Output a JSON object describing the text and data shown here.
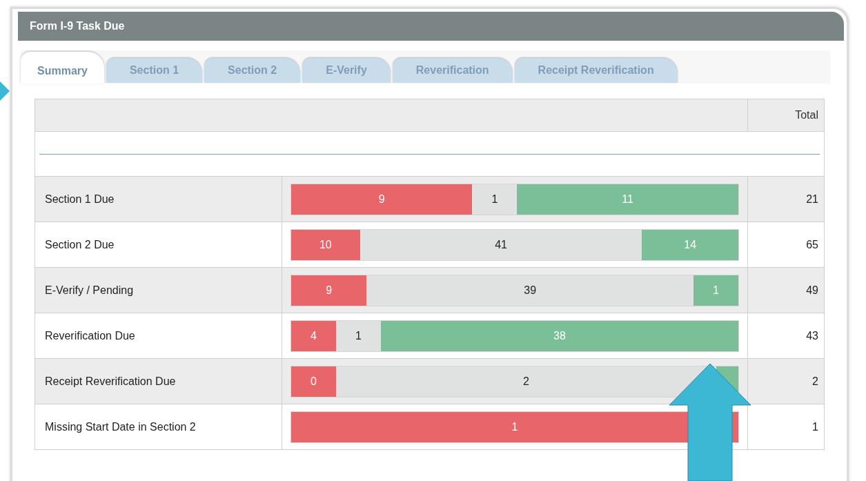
{
  "panel": {
    "title": "Form I-9 Task Due"
  },
  "tabs": [
    {
      "label": "Summary",
      "selected": true
    },
    {
      "label": "Section 1",
      "selected": false
    },
    {
      "label": "Section 2",
      "selected": false
    },
    {
      "label": "E-Verify",
      "selected": false
    },
    {
      "label": "Reverification",
      "selected": false
    },
    {
      "label": "Receipt Reverification",
      "selected": false
    }
  ],
  "table": {
    "columns": {
      "column_3": "Total"
    },
    "rows": [
      {
        "label": "Section 1 Due",
        "total": "21",
        "segments": [
          {
            "kind": "overdue",
            "text": "9"
          },
          {
            "kind": "pending",
            "text": "1"
          },
          {
            "kind": "ontime",
            "text": "11"
          }
        ]
      },
      {
        "label": "Section 2 Due",
        "total": "65",
        "segments": [
          {
            "kind": "overdue",
            "text": "10"
          },
          {
            "kind": "pending",
            "text": "41"
          },
          {
            "kind": "ontime",
            "text": "14"
          }
        ]
      },
      {
        "label": "E-Verify / Pending",
        "total": "49",
        "segments": [
          {
            "kind": "overdue",
            "text": "9"
          },
          {
            "kind": "pending",
            "text": "39"
          },
          {
            "kind": "ontime",
            "text": "1"
          }
        ]
      },
      {
        "label": "Reverification Due",
        "total": "43",
        "segments": [
          {
            "kind": "overdue",
            "text": "4"
          },
          {
            "kind": "pending",
            "text": "1"
          },
          {
            "kind": "ontime",
            "text": "38"
          }
        ]
      },
      {
        "label": "Receipt Reverification Due",
        "total": "2",
        "segments": [
          {
            "kind": "overdue",
            "text": "0"
          },
          {
            "kind": "pending",
            "text": "2"
          },
          {
            "kind": "ontime"
          }
        ]
      },
      {
        "label": "Missing Start Date in Section 2",
        "total": "1",
        "segments": [
          {
            "kind": "overdue",
            "text": "1"
          }
        ]
      }
    ]
  }
}
